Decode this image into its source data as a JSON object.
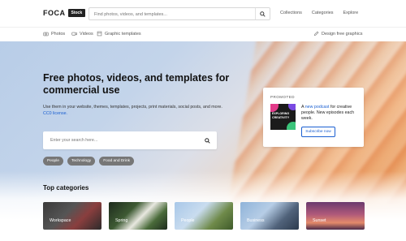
{
  "header": {
    "logo_text": "FOCA",
    "logo_badge": "Stock",
    "search_placeholder": "Find photos, videos, and templates...",
    "nav": [
      "Collections",
      "Categories",
      "Explore"
    ]
  },
  "subnav": {
    "photos": "Photos",
    "videos": "Videos",
    "templates": "Graphic templates",
    "design": "Design free graphics"
  },
  "hero": {
    "title": "Free photos, videos, and templates for commercial use",
    "desc_prefix": "Use them in your website, themes, templates, projects, print materials, social posts, and more.",
    "desc_link": "CC0 license.",
    "search_placeholder": "Enter your search here...",
    "tags": [
      "People",
      "Technology",
      "Food and Drink"
    ]
  },
  "promo": {
    "label": "PROMOTED",
    "image_text": "EXPLORING CREATIVITY",
    "text_prefix": "A",
    "text_link": "new podcast",
    "text_suffix": "for creative people. New episodes each week.",
    "button": "Subscribe now"
  },
  "categories": {
    "heading": "Top categories",
    "items": [
      "Workspace",
      "Spring",
      "People",
      "Business",
      "Sunset"
    ]
  },
  "colors": {
    "accent_link": "#1a5fd1",
    "tag_bg": "#777777"
  }
}
